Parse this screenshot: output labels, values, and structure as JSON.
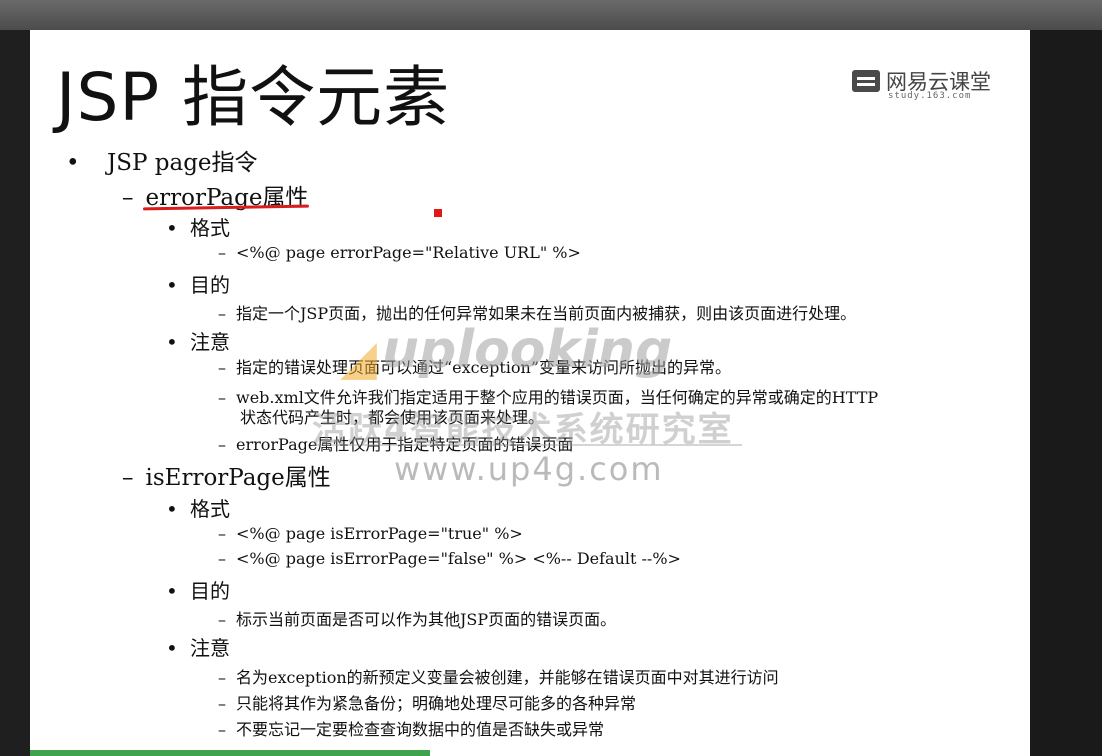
{
  "slide": {
    "title": "JSP 指令元素",
    "logo": {
      "name": "网易云课堂",
      "sub": "study.163.com"
    },
    "items": [
      {
        "text": "JSP page指令"
      },
      {
        "text": "errorPage属性"
      },
      {
        "text": "格式"
      },
      {
        "text": "<%@ page errorPage=\"Relative URL\" %>"
      },
      {
        "text": "目的"
      },
      {
        "text": "指定一个JSP页面，抛出的任何异常如果未在当前页面内被捕获，则由该页面进行处理。"
      },
      {
        "text": "注意"
      },
      {
        "text": "指定的错误处理页面可以通过“exception”变量来访问所抛出的异常。"
      },
      {
        "text": "web.xml文件允许我们指定适用于整个应用的错误页面，当任何确定的异常或确定的HTTP"
      },
      {
        "text": "状态代码产生时，都会使用该页面来处理。"
      },
      {
        "text": "errorPage属性仅用于指定特定页面的错误页面"
      },
      {
        "text": "isErrorPage属性"
      },
      {
        "text": "格式"
      },
      {
        "text": "<%@ page isErrorPage=\"true\" %>"
      },
      {
        "text": "<%@ page isErrorPage=\"false\" %> <%-- Default --%>"
      },
      {
        "text": "目的"
      },
      {
        "text": "标示当前页面是否可以作为其他JSP页面的错误页面。"
      },
      {
        "text": "注意"
      },
      {
        "text": "名为exception的新预定义变量会被创建，并能够在错误页面中对其进行访问"
      },
      {
        "text": "只能将其作为紧急备份；明确地处理尽可能多的各种异常"
      },
      {
        "text": "不要忘记一定要检查查询数据中的值是否缺失或异常"
      }
    ],
    "markers": {
      "dot": "•",
      "dash": "–"
    },
    "watermark": {
      "brand": "uplooking",
      "cn": "活跃4智能技术系统研究室",
      "url": "www.up4g.com"
    }
  },
  "colors": {
    "underline": "#d91c1c",
    "logo": "#4a4a4a",
    "bottom_accent": "#3fa34d"
  },
  "icons": [
    "netease-cloud-classroom-logo-icon",
    "uplooking-logo-icon"
  ]
}
